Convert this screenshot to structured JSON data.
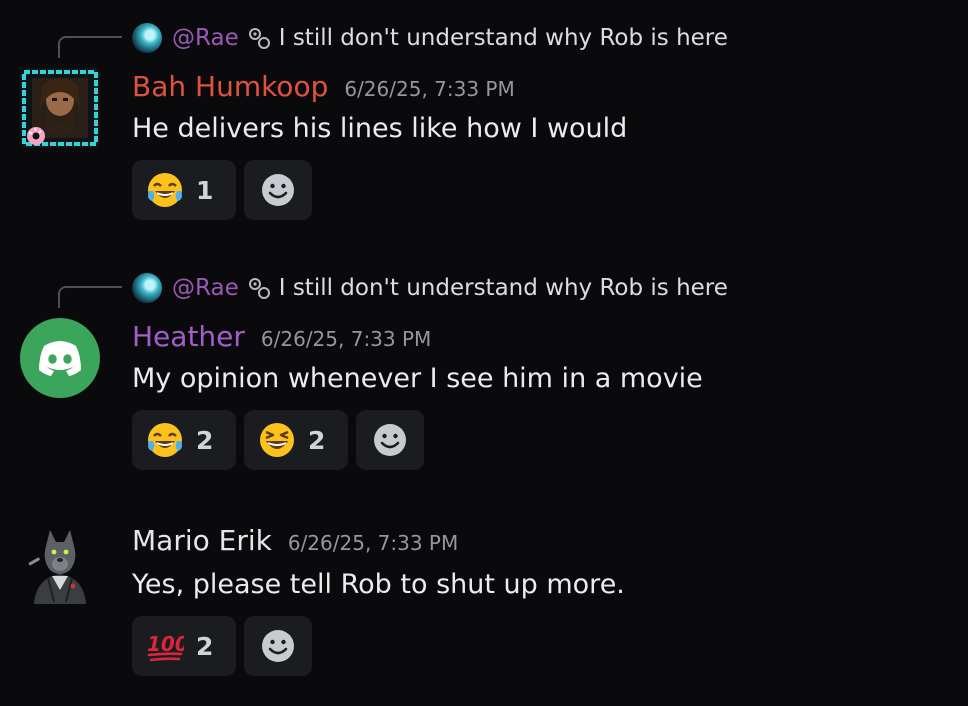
{
  "colors": {
    "background": "#0a0a0c",
    "reply_name": "#9b59b6",
    "bah_name": "#e0523f",
    "heather_name": "#a35fc9",
    "mario_name": "#e6e6e9",
    "heather_avatar_bg": "#3ba55c"
  },
  "messages": [
    {
      "reply": {
        "name": "@Rae",
        "link_icon": "thread-link-icon",
        "text": "I still don't understand why Rob is here"
      },
      "author": "Bah Humkoop",
      "timestamp": "6/26/25, 7:33 PM",
      "text": "He delivers his lines like how I would",
      "reactions": [
        {
          "emoji": "joy-emoji",
          "count": "1"
        }
      ]
    },
    {
      "reply": {
        "name": "@Rae",
        "link_icon": "thread-link-icon",
        "text": "I still don't understand why Rob is here"
      },
      "author": "Heather",
      "timestamp": "6/26/25, 7:33 PM",
      "text": "My opinion whenever I see him in a movie",
      "reactions": [
        {
          "emoji": "joy-emoji",
          "count": "2"
        },
        {
          "emoji": "laughing-emoji",
          "count": "2"
        }
      ]
    },
    {
      "author": "Mario Erik",
      "timestamp": "6/26/25, 7:33 PM",
      "text": "Yes, please tell Rob to shut up more.",
      "reactions": [
        {
          "emoji": "hundred-points-emoji",
          "count": "2"
        }
      ]
    }
  ]
}
